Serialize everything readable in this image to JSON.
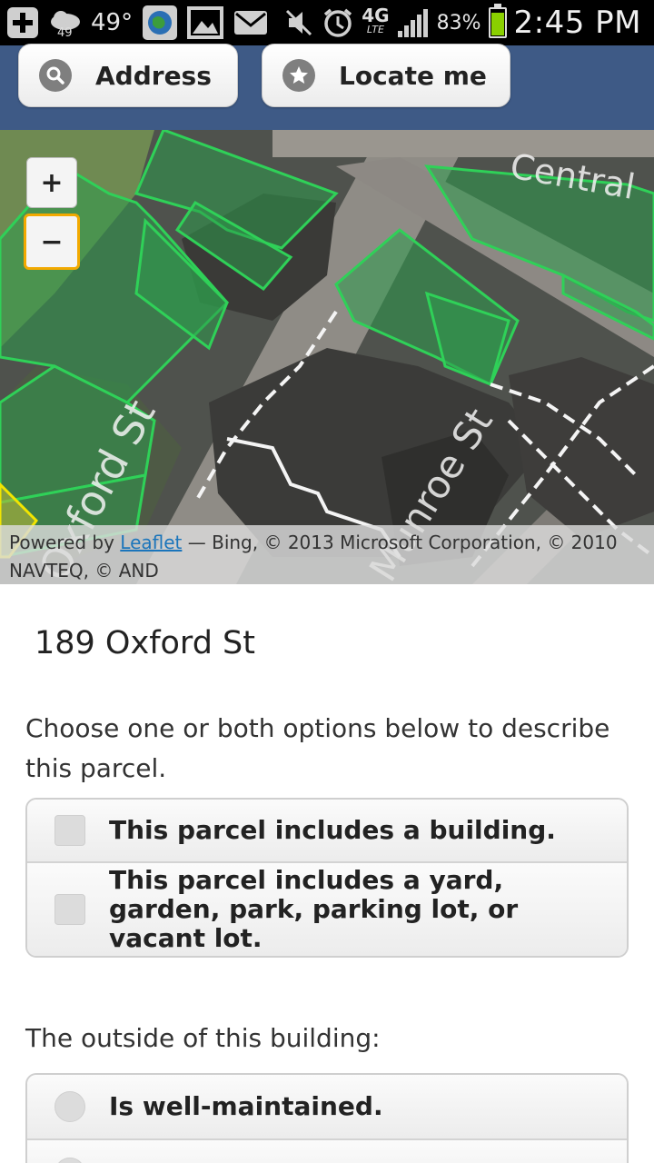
{
  "status_bar": {
    "notification_count": "49",
    "temperature": "49°",
    "network": "4G",
    "network_sub": "LTE",
    "battery_percent": "83%",
    "time": "2:45 PM",
    "icons": [
      "add-icon",
      "weather-icon",
      "globe-icon",
      "gallery-icon",
      "mail-icon",
      "mute-icon",
      "alarm-icon",
      "signal-icon",
      "battery-icon"
    ]
  },
  "header": {
    "address_button": "Address",
    "address_icon": "search-icon",
    "locate_button": "Locate me",
    "locate_icon": "star-icon",
    "background_color": "#3e5a86"
  },
  "map": {
    "zoom_in": "+",
    "zoom_out": "−",
    "labels": {
      "central": "Central",
      "oxford": "Oxford St",
      "munroe": "Munroe St"
    },
    "attribution": {
      "prefix": "Powered by ",
      "leaflet": "Leaflet",
      "rest": " — Bing, © 2013 Microsoft Corporation, © 2010 NAVTEQ, © AND"
    },
    "parcel_color": "#2fd158"
  },
  "parcel": {
    "address": "189 Oxford St",
    "instructions": "Choose one or both options below to describe this parcel.",
    "use_options": [
      {
        "label": "This parcel includes a building."
      },
      {
        "label": "This parcel includes a yard, garden, park, parking lot, or vacant lot."
      }
    ],
    "condition_question": "The outside of this building:",
    "condition_options": [
      {
        "label": "Is well-maintained."
      }
    ]
  }
}
